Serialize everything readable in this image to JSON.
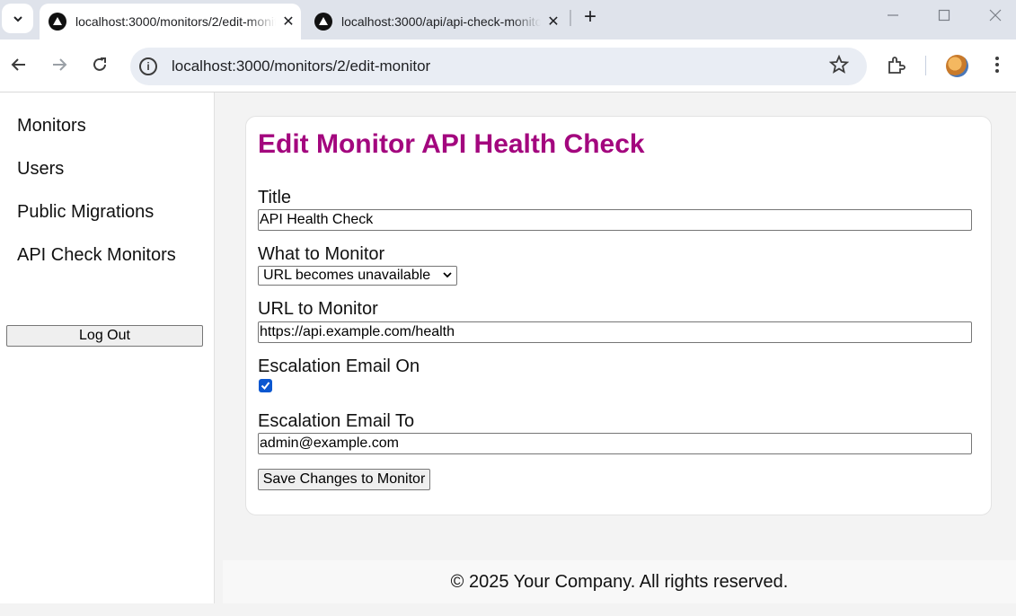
{
  "browser": {
    "tabs": [
      {
        "title": "localhost:3000/monitors/2/edit-monitor",
        "active": true
      },
      {
        "title": "localhost:3000/api/api-check-monitors",
        "active": false
      }
    ],
    "tab_close_glyph": "✕",
    "new_tab_glyph": "+",
    "url": "localhost:3000/monitors/2/edit-monitor",
    "icons": {
      "tab_search": "chevron-down-icon",
      "back": "back-arrow-icon",
      "forward": "forward-arrow-icon",
      "reload": "reload-icon",
      "site_info": "info-icon",
      "bookmark": "star-icon",
      "extensions": "puzzle-icon",
      "profile": "avatar",
      "menu": "kebab-menu-icon"
    }
  },
  "sidebar": {
    "items": [
      {
        "label": "Monitors"
      },
      {
        "label": "Users"
      },
      {
        "label": "Public Migrations"
      },
      {
        "label": "API Check Monitors"
      }
    ],
    "logout_label": "Log Out"
  },
  "form": {
    "heading": "Edit Monitor API Health Check",
    "title_label": "Title",
    "title_value": "API Health Check",
    "what_label": "What to Monitor",
    "what_value": "URL becomes unavailable",
    "url_label": "URL to Monitor",
    "url_value": "https://api.example.com/health",
    "escalation_on_label": "Escalation Email On",
    "escalation_on_checked": true,
    "escalation_to_label": "Escalation Email To",
    "escalation_to_value": "admin@example.com",
    "save_label": "Save Changes to Monitor"
  },
  "footer": {
    "text": "© 2025 Your Company. All rights reserved."
  },
  "colors": {
    "heading": "#a3067e",
    "checkbox": "#0b57d0",
    "tabstrip": "#dfe3eb",
    "omnibox": "#e9edf4"
  }
}
